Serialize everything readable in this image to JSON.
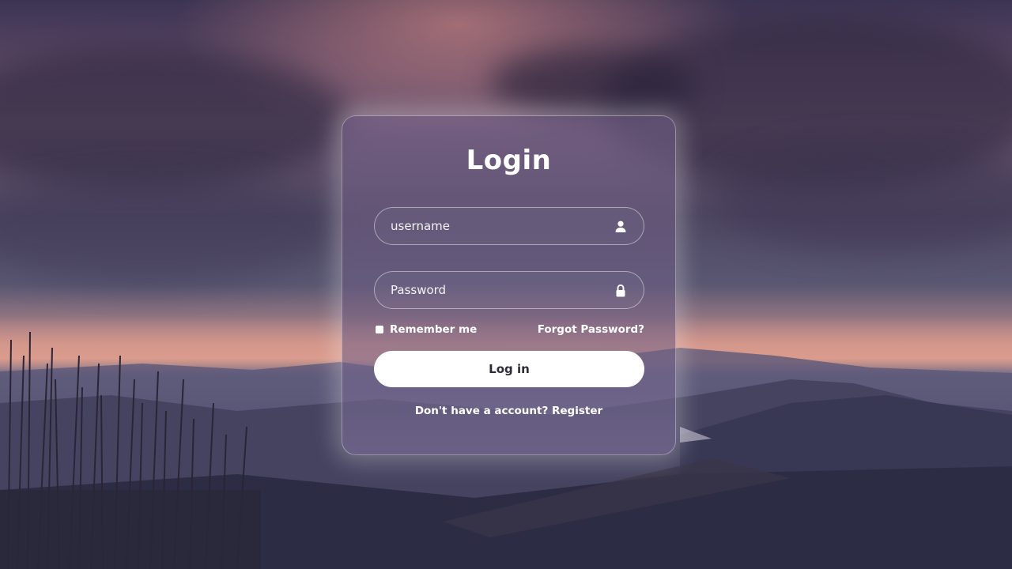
{
  "login_form": {
    "title": "Login",
    "username": {
      "placeholder": "username",
      "value": "",
      "icon": "user-icon"
    },
    "password": {
      "placeholder": "Password",
      "value": "",
      "icon": "lock-icon"
    },
    "remember_label": "Remember me",
    "forgot_label": "Forgot Password?",
    "submit_label": "Log in",
    "register_prompt": "Don't have a account?",
    "register_link": "Register"
  },
  "colors": {
    "card_text": "#ffffff",
    "button_bg": "#ffffff",
    "button_text": "#2f2a3a"
  }
}
